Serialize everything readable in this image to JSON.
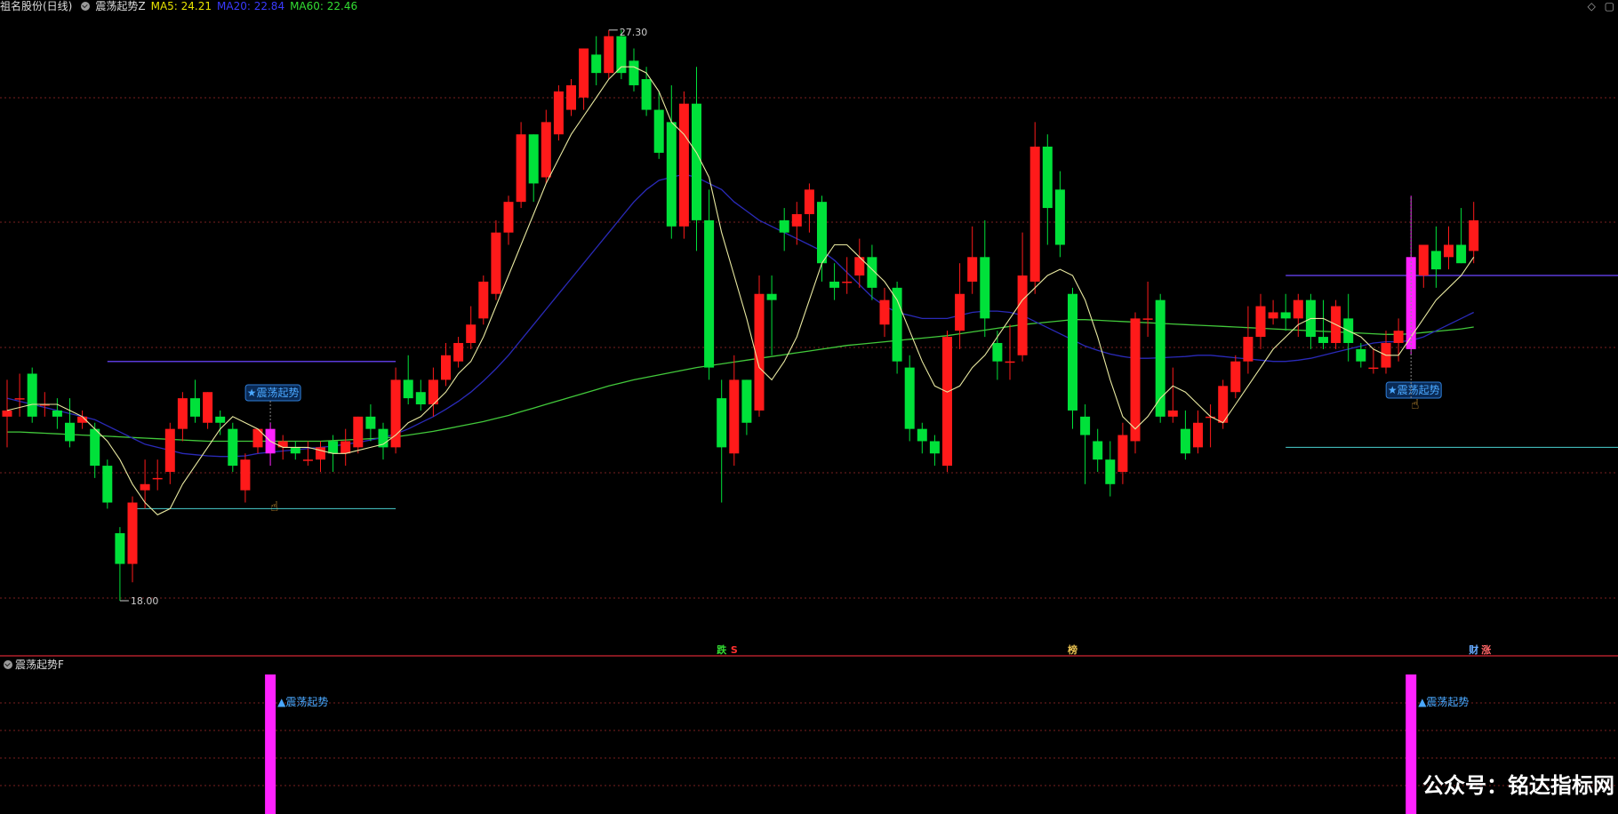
{
  "header": {
    "stock_label": "祖名股份(日线)",
    "indicator_name": "震荡起势Z",
    "ma5": "MA5: 24.21",
    "ma20": "MA20: 22.84",
    "ma60": "MA60: 22.46",
    "colors": {
      "ma5": "#e8e400",
      "ma20": "#2a2aff",
      "ma60": "#33dd33"
    }
  },
  "window_controls": {
    "diamond_icon": "◇",
    "restore_icon": "▢"
  },
  "sub_panel": {
    "title": "震荡起势F"
  },
  "watermark": "公众号：铭达指标网",
  "chart_data": {
    "type": "candlestick",
    "y_range": [
      18.0,
      27.5
    ],
    "max_label": "27.30",
    "min_label": "18.00",
    "colors": {
      "up": "#ff1a1a",
      "down": "#00e13a",
      "signal": "#ff22ff",
      "ma5": "#e8e8a0",
      "ma20": "#2a2ab8",
      "ma60": "#42c93b"
    },
    "candles": [
      [
        21.0,
        21.1,
        21.6,
        20.5
      ],
      [
        21.3,
        21.3,
        21.7,
        21.0
      ],
      [
        21.7,
        21.0,
        21.8,
        20.9
      ],
      [
        21.2,
        21.2,
        21.4,
        21.0
      ],
      [
        21.1,
        21.0,
        21.3,
        20.8
      ],
      [
        20.9,
        20.6,
        21.3,
        20.5
      ],
      [
        20.9,
        21.0,
        21.1,
        20.8
      ],
      [
        20.8,
        20.2,
        20.9,
        20.0
      ],
      [
        20.2,
        19.6,
        20.3,
        19.5
      ],
      [
        19.1,
        18.6,
        19.2,
        18.0
      ],
      [
        18.6,
        19.6,
        19.7,
        18.3
      ],
      [
        19.8,
        19.9,
        20.3,
        19.5
      ],
      [
        20.0,
        20.0,
        20.3,
        19.8
      ],
      [
        20.1,
        20.8,
        20.9,
        19.9
      ],
      [
        20.8,
        21.3,
        21.4,
        20.6
      ],
      [
        21.3,
        21.0,
        21.6,
        20.9
      ],
      [
        20.9,
        21.4,
        21.4,
        20.8
      ],
      [
        21.0,
        20.9,
        21.1,
        20.7
      ],
      [
        20.8,
        20.2,
        20.9,
        20.1
      ],
      [
        19.8,
        20.3,
        20.4,
        19.6
      ],
      [
        20.5,
        20.8,
        20.8,
        20.4
      ],
      [
        20.8,
        20.4,
        20.9,
        20.2
      ],
      [
        20.5,
        20.6,
        20.7,
        20.3
      ],
      [
        20.5,
        20.4,
        20.6,
        20.3
      ],
      [
        20.3,
        20.3,
        20.6,
        20.2
      ],
      [
        20.3,
        20.5,
        20.6,
        20.1
      ],
      [
        20.6,
        20.4,
        20.7,
        20.1
      ],
      [
        20.4,
        20.6,
        20.8,
        20.2
      ],
      [
        20.5,
        21.0,
        21.0,
        20.4
      ],
      [
        21.0,
        20.8,
        21.2,
        20.6
      ],
      [
        20.8,
        20.5,
        20.9,
        20.3
      ],
      [
        20.5,
        21.6,
        21.8,
        20.4
      ],
      [
        21.6,
        21.3,
        22.0,
        21.2
      ],
      [
        21.4,
        21.2,
        21.6,
        21.1
      ],
      [
        21.2,
        21.6,
        21.8,
        21.0
      ],
      [
        21.6,
        22.0,
        22.2,
        21.5
      ],
      [
        21.9,
        22.2,
        22.3,
        21.8
      ],
      [
        22.2,
        22.5,
        22.8,
        22.1
      ],
      [
        22.6,
        23.2,
        23.3,
        22.5
      ],
      [
        23.0,
        24.0,
        24.2,
        22.9
      ],
      [
        24.0,
        24.5,
        24.6,
        23.8
      ],
      [
        24.5,
        25.6,
        25.8,
        24.4
      ],
      [
        25.6,
        24.8,
        25.6,
        24.5
      ],
      [
        24.9,
        25.8,
        26.0,
        24.8
      ],
      [
        25.6,
        26.3,
        26.4,
        25.5
      ],
      [
        26.0,
        26.4,
        26.5,
        25.9
      ],
      [
        26.2,
        27.0,
        27.0,
        26.0
      ],
      [
        26.9,
        26.6,
        27.2,
        26.4
      ],
      [
        26.6,
        27.2,
        27.3,
        26.5
      ],
      [
        27.2,
        26.6,
        27.3,
        26.5
      ],
      [
        26.8,
        26.4,
        27.0,
        26.3
      ],
      [
        26.5,
        26.0,
        26.7,
        25.9
      ],
      [
        26.0,
        25.3,
        26.3,
        25.2
      ],
      [
        25.8,
        24.1,
        26.4,
        23.9
      ],
      [
        24.1,
        26.1,
        26.3,
        23.9
      ],
      [
        26.1,
        24.2,
        26.7,
        23.7
      ],
      [
        24.2,
        21.8,
        24.7,
        21.6
      ],
      [
        21.3,
        20.5,
        21.6,
        19.6
      ],
      [
        20.4,
        21.6,
        22.0,
        20.2
      ],
      [
        21.6,
        20.9,
        21.6,
        20.7
      ],
      [
        21.1,
        23.0,
        23.3,
        21.0
      ],
      [
        23.0,
        22.9,
        23.3,
        22.0
      ],
      [
        24.2,
        24.0,
        24.4,
        23.7
      ],
      [
        24.1,
        24.3,
        24.5,
        23.8
      ],
      [
        24.3,
        24.7,
        24.8,
        24.0
      ],
      [
        24.5,
        23.5,
        24.6,
        23.2
      ],
      [
        23.2,
        23.1,
        23.5,
        22.9
      ],
      [
        23.2,
        23.2,
        23.6,
        23.0
      ],
      [
        23.3,
        23.6,
        23.9,
        23.1
      ],
      [
        23.6,
        23.1,
        23.8,
        22.9
      ],
      [
        22.5,
        22.9,
        23.1,
        22.3
      ],
      [
        23.1,
        21.9,
        23.2,
        21.7
      ],
      [
        21.8,
        20.8,
        22.0,
        20.6
      ],
      [
        20.8,
        20.6,
        20.9,
        20.4
      ],
      [
        20.6,
        20.4,
        20.7,
        20.2
      ],
      [
        20.2,
        22.3,
        22.4,
        20.1
      ],
      [
        22.4,
        23.0,
        23.5,
        22.1
      ],
      [
        23.2,
        23.6,
        24.1,
        23.0
      ],
      [
        23.6,
        22.6,
        24.2,
        22.3
      ],
      [
        22.2,
        21.9,
        22.4,
        21.6
      ],
      [
        21.9,
        21.9,
        22.5,
        21.6
      ],
      [
        22.0,
        23.3,
        24.0,
        21.9
      ],
      [
        23.2,
        25.4,
        25.8,
        23.0
      ],
      [
        25.4,
        24.4,
        25.6,
        23.8
      ],
      [
        24.7,
        23.8,
        25.0,
        23.6
      ],
      [
        23.0,
        21.1,
        23.1,
        20.8
      ],
      [
        21.0,
        20.7,
        21.2,
        19.9
      ],
      [
        20.6,
        20.3,
        20.8,
        20.1
      ],
      [
        20.3,
        19.9,
        20.6,
        19.7
      ],
      [
        20.1,
        20.7,
        20.9,
        19.9
      ],
      [
        20.6,
        22.6,
        22.7,
        20.4
      ],
      [
        22.6,
        22.6,
        23.2,
        22.3
      ],
      [
        22.9,
        21.0,
        23.0,
        20.9
      ],
      [
        21.0,
        21.1,
        21.8,
        20.9
      ],
      [
        20.8,
        20.4,
        21.1,
        20.3
      ],
      [
        20.5,
        20.9,
        21.1,
        20.4
      ],
      [
        21.0,
        21.0,
        21.2,
        20.5
      ],
      [
        20.9,
        21.5,
        21.6,
        20.8
      ],
      [
        21.4,
        21.9,
        22.0,
        21.3
      ],
      [
        21.9,
        22.3,
        22.8,
        21.7
      ],
      [
        22.3,
        22.8,
        23.0,
        22.1
      ],
      [
        22.6,
        22.7,
        22.9,
        22.5
      ],
      [
        22.7,
        22.6,
        23.0,
        22.4
      ],
      [
        22.6,
        22.9,
        23.0,
        22.3
      ],
      [
        22.9,
        22.3,
        23.0,
        22.1
      ],
      [
        22.3,
        22.2,
        22.9,
        22.1
      ],
      [
        22.2,
        22.8,
        22.9,
        22.1
      ],
      [
        22.6,
        22.2,
        23.0,
        21.9
      ],
      [
        22.1,
        21.9,
        22.2,
        21.8
      ],
      [
        21.8,
        21.8,
        22.1,
        21.7
      ],
      [
        21.8,
        22.2,
        22.4,
        21.7
      ],
      [
        22.2,
        22.4,
        22.6,
        21.9
      ],
      [
        22.1,
        23.6,
        24.6,
        22.0
      ],
      [
        23.3,
        23.8,
        23.8,
        23.1
      ],
      [
        23.7,
        23.4,
        24.1,
        23.1
      ],
      [
        23.6,
        23.8,
        24.1,
        23.4
      ],
      [
        23.8,
        23.5,
        24.4,
        23.5
      ],
      [
        23.7,
        24.2,
        24.5,
        23.5
      ]
    ],
    "ma5": [
      21.1,
      21.15,
      21.2,
      21.2,
      21.2,
      21.1,
      21.0,
      20.8,
      20.6,
      20.3,
      19.9,
      19.6,
      19.4,
      19.5,
      19.9,
      20.2,
      20.5,
      20.8,
      21.0,
      20.9,
      20.8,
      20.6,
      20.5,
      20.5,
      20.5,
      20.45,
      20.4,
      20.4,
      20.45,
      20.5,
      20.55,
      20.7,
      20.9,
      21.0,
      21.2,
      21.4,
      21.7,
      21.9,
      22.3,
      22.8,
      23.3,
      23.8,
      24.3,
      24.8,
      25.2,
      25.6,
      25.9,
      26.2,
      26.5,
      26.7,
      26.7,
      26.6,
      26.3,
      25.8,
      25.6,
      25.3,
      24.9,
      24.0,
      23.3,
      22.6,
      21.8,
      21.6,
      21.9,
      22.3,
      22.9,
      23.5,
      23.8,
      23.8,
      23.6,
      23.4,
      23.2,
      22.9,
      22.4,
      21.9,
      21.5,
      21.4,
      21.5,
      21.8,
      22.0,
      22.3,
      22.6,
      22.9,
      23.1,
      23.3,
      23.4,
      23.3,
      22.9,
      22.3,
      21.6,
      21.0,
      20.8,
      21.0,
      21.3,
      21.5,
      21.4,
      21.2,
      21.0,
      20.9,
      21.2,
      21.5,
      21.8,
      22.1,
      22.3,
      22.5,
      22.6,
      22.6,
      22.5,
      22.4,
      22.3,
      22.1,
      22.0,
      22.0,
      22.3,
      22.6,
      22.9,
      23.1,
      23.3,
      23.6
    ],
    "ma20": [
      21.3,
      21.25,
      21.2,
      21.15,
      21.1,
      21.05,
      21.0,
      20.95,
      20.85,
      20.75,
      20.65,
      20.55,
      20.5,
      20.45,
      20.4,
      20.38,
      20.36,
      20.35,
      20.35,
      20.36,
      20.4,
      20.42,
      20.44,
      20.46,
      20.48,
      20.5,
      20.52,
      20.55,
      20.58,
      20.62,
      20.66,
      20.72,
      20.8,
      20.9,
      21.0,
      21.12,
      21.25,
      21.4,
      21.58,
      21.78,
      22.0,
      22.25,
      22.5,
      22.75,
      23.0,
      23.25,
      23.5,
      23.75,
      24.0,
      24.25,
      24.5,
      24.7,
      24.85,
      24.9,
      24.95,
      24.9,
      24.8,
      24.7,
      24.5,
      24.35,
      24.2,
      24.1,
      24.0,
      23.9,
      23.8,
      23.7,
      23.55,
      23.35,
      23.15,
      22.95,
      22.8,
      22.7,
      22.65,
      22.6,
      22.6,
      22.6,
      22.65,
      22.7,
      22.72,
      22.72,
      22.7,
      22.65,
      22.55,
      22.45,
      22.35,
      22.25,
      22.15,
      22.08,
      22.02,
      21.98,
      21.95,
      21.95,
      21.96,
      21.97,
      21.98,
      22.0,
      22.0,
      21.98,
      21.96,
      21.94,
      21.92,
      21.9,
      21.9,
      21.92,
      21.95,
      22.0,
      22.05,
      22.1,
      22.15,
      22.2,
      22.22,
      22.22,
      22.24,
      22.3,
      22.4,
      22.5,
      22.6,
      22.7
    ],
    "ma60": [
      20.75,
      20.75,
      20.74,
      20.73,
      20.72,
      20.71,
      20.7,
      20.69,
      20.68,
      20.67,
      20.66,
      20.65,
      20.64,
      20.63,
      20.62,
      20.61,
      20.6,
      20.6,
      20.6,
      20.6,
      20.6,
      20.6,
      20.6,
      20.6,
      20.6,
      20.6,
      20.61,
      20.62,
      20.63,
      20.64,
      20.65,
      20.67,
      20.7,
      20.73,
      20.76,
      20.8,
      20.84,
      20.88,
      20.92,
      20.97,
      21.02,
      21.08,
      21.14,
      21.2,
      21.26,
      21.32,
      21.38,
      21.44,
      21.5,
      21.55,
      21.6,
      21.64,
      21.68,
      21.72,
      21.76,
      21.8,
      21.83,
      21.86,
      21.89,
      21.92,
      21.95,
      21.98,
      22.01,
      22.04,
      22.07,
      22.1,
      22.13,
      22.16,
      22.18,
      22.2,
      22.22,
      22.24,
      22.26,
      22.28,
      22.3,
      22.32,
      22.35,
      22.38,
      22.41,
      22.44,
      22.47,
      22.5,
      22.52,
      22.54,
      22.56,
      22.58,
      22.58,
      22.57,
      22.56,
      22.55,
      22.54,
      22.53,
      22.52,
      22.51,
      22.5,
      22.49,
      22.48,
      22.47,
      22.46,
      22.45,
      22.44,
      22.43,
      22.42,
      22.41,
      22.4,
      22.39,
      22.38,
      22.37,
      22.36,
      22.35,
      22.34,
      22.34,
      22.35,
      22.37,
      22.39,
      22.41,
      22.43,
      22.46
    ],
    "signals": [
      {
        "index": 21,
        "label": "★震荡起势",
        "sub_label": "▲震荡起势",
        "upper_price": 21.9,
        "lower_price": 19.5
      },
      {
        "index": 112,
        "label": "★震荡起势",
        "sub_label": "▲震荡起势",
        "upper_price": 23.3,
        "lower_price": 20.5
      }
    ],
    "markers": [
      {
        "index": 57,
        "text": "跌",
        "color": "#33dd33"
      },
      {
        "index": 58,
        "text": "S",
        "color": "#ff3030"
      },
      {
        "index": 85,
        "text": "榜",
        "color": "#e8c050"
      },
      {
        "index": 117,
        "text": "财",
        "color": "#66aaff"
      },
      {
        "index": 118,
        "text": "涨",
        "color": "#ff6666"
      }
    ]
  }
}
